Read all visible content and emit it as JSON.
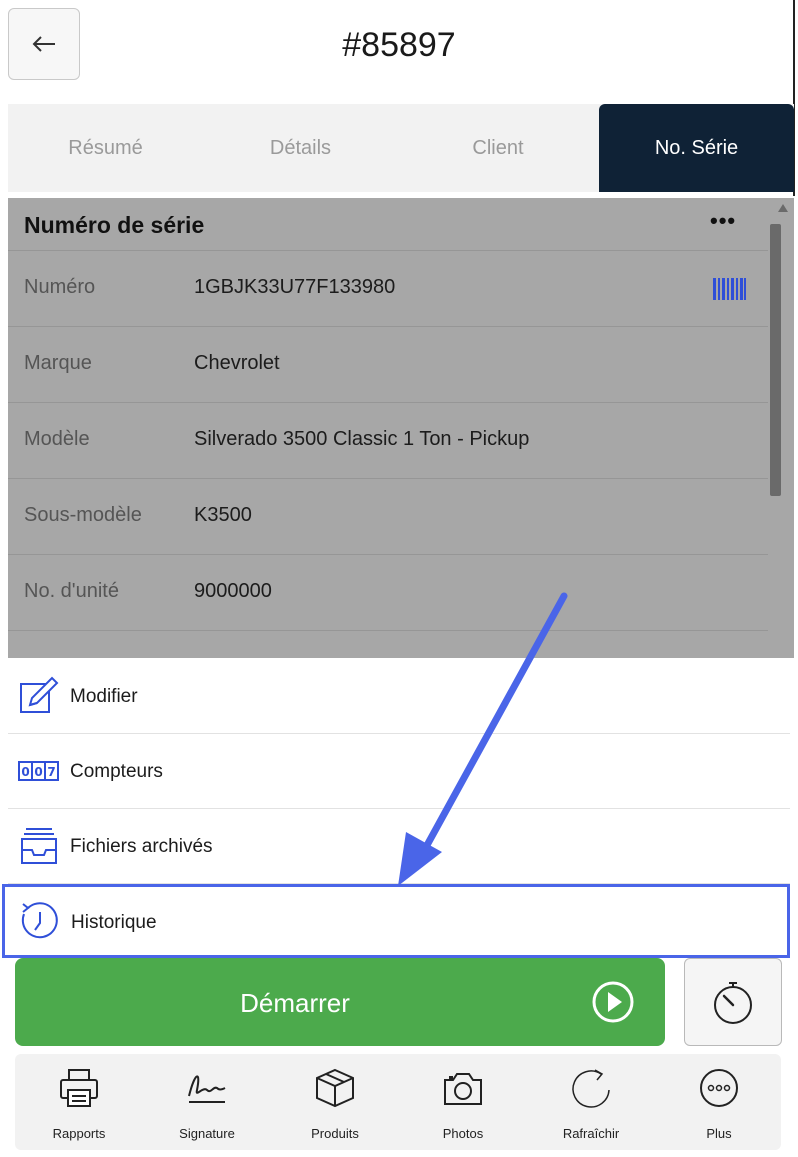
{
  "header": {
    "title": "#85897",
    "back_icon": "arrow-left-icon"
  },
  "tabs": [
    {
      "label": "Résumé",
      "active": false
    },
    {
      "label": "Détails",
      "active": false
    },
    {
      "label": "Client",
      "active": false
    },
    {
      "label": "No. Série",
      "active": true
    }
  ],
  "serial": {
    "title": "Numéro de série",
    "menu_icon": "more-horizontal-icon",
    "rows": [
      {
        "label": "Numéro",
        "value": "1GBJK33U77F133980",
        "icon": "barcode-icon"
      },
      {
        "label": "Marque",
        "value": "Chevrolet"
      },
      {
        "label": "Modèle",
        "value": "Silverado 3500 Classic 1 Ton - Pickup"
      },
      {
        "label": "Sous-modèle",
        "value": "K3500"
      },
      {
        "label": "No. d'unité",
        "value": "9000000"
      }
    ]
  },
  "menu": [
    {
      "label": "Modifier",
      "icon": "edit-icon"
    },
    {
      "label": "Compteurs",
      "icon": "counter-icon"
    },
    {
      "label": "Fichiers archivés",
      "icon": "archive-icon"
    },
    {
      "label": "Historique",
      "icon": "history-icon"
    }
  ],
  "actions": {
    "start_label": "Démarrer",
    "start_icon": "play-circle-icon",
    "timer_icon": "stopwatch-icon"
  },
  "toolbar": [
    {
      "label": "Rapports",
      "icon": "printer-icon"
    },
    {
      "label": "Signature",
      "icon": "signature-icon"
    },
    {
      "label": "Produits",
      "icon": "box-icon"
    },
    {
      "label": "Photos",
      "icon": "camera-icon"
    },
    {
      "label": "Rafraîchir",
      "icon": "refresh-icon"
    },
    {
      "label": "Plus",
      "icon": "more-circle-icon"
    }
  ],
  "colors": {
    "accent": "#0f2236",
    "start": "#4caa4c",
    "highlight": "#4a65e8",
    "barcode": "#2f4fd8"
  }
}
